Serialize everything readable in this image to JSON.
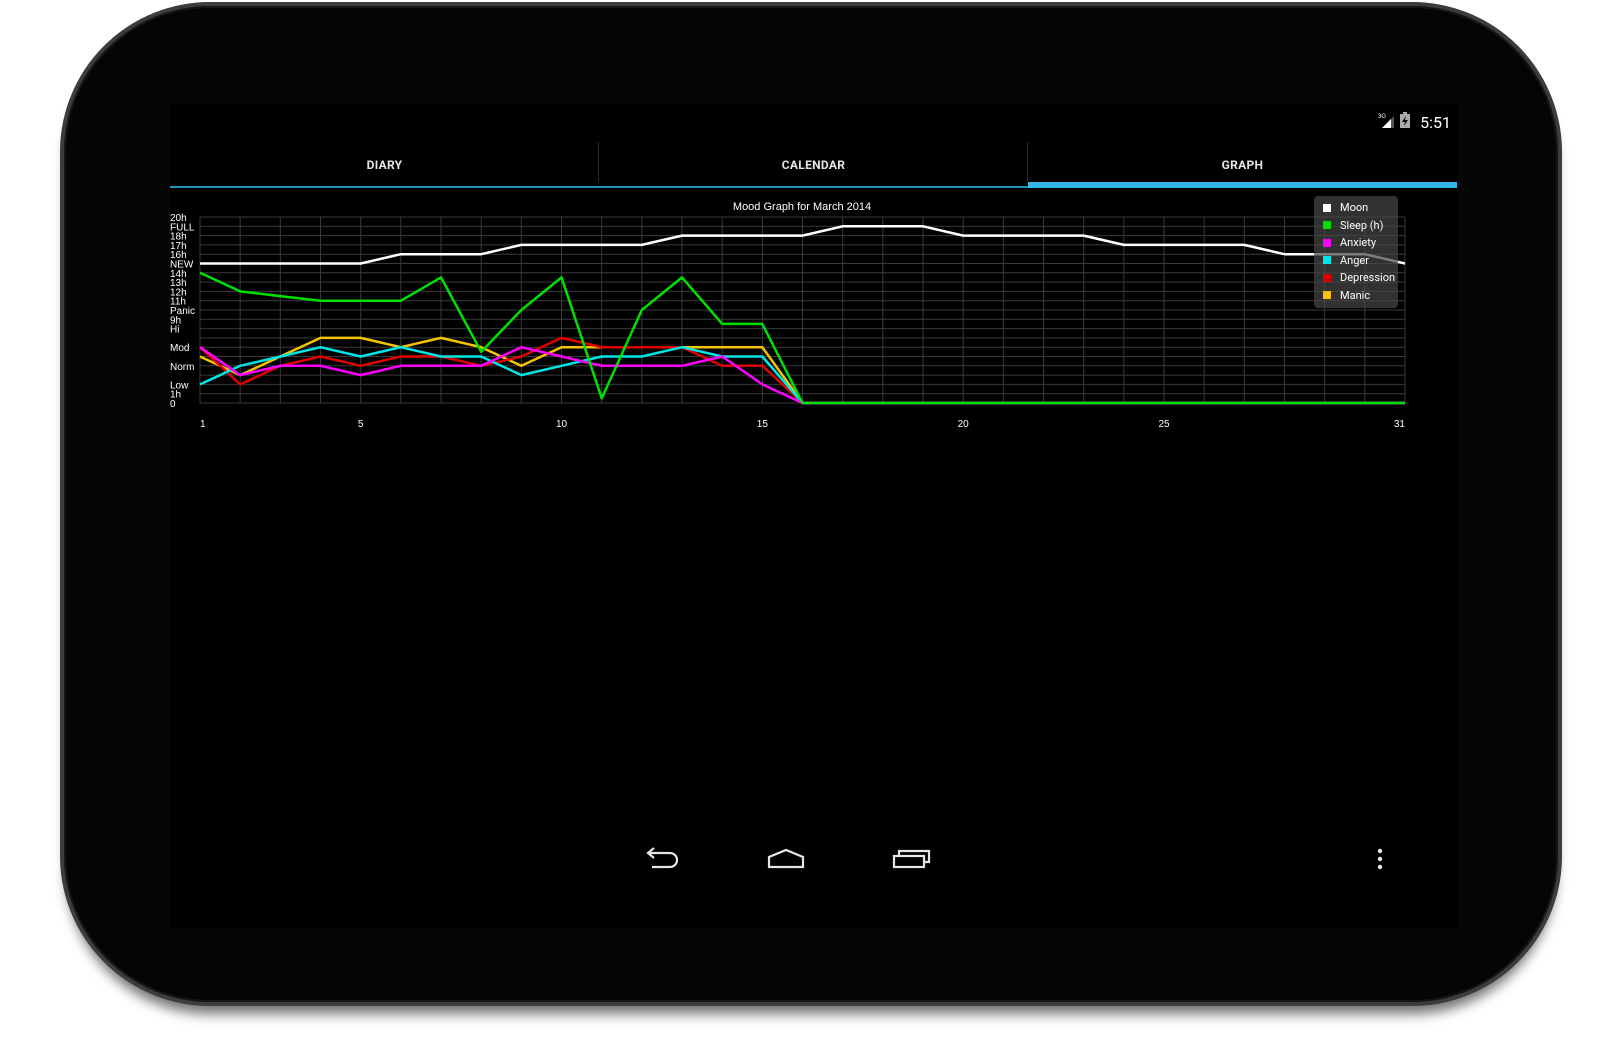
{
  "status_bar": {
    "network_label": "3G",
    "time": "5:51",
    "icons": [
      "signal-3g-icon",
      "battery-charging-icon"
    ]
  },
  "tabs": [
    {
      "label": "DIARY",
      "selected": false
    },
    {
      "label": "CALENDAR",
      "selected": false
    },
    {
      "label": "GRAPH",
      "selected": true
    }
  ],
  "colors": {
    "accent": "#33b5e5",
    "tab_indicator": "#2390b8",
    "moon": "#ffffff",
    "sleep": "#00e000",
    "anxiety": "#ff00ff",
    "anger": "#00e5e5",
    "depression": "#e00000",
    "manic": "#f5c400"
  },
  "chart_data": {
    "type": "line",
    "title": "Mood Graph for March 2014",
    "x_ticks": [
      1,
      5,
      10,
      15,
      20,
      25,
      31
    ],
    "xlim": [
      1,
      31
    ],
    "ylim": [
      0,
      20
    ],
    "grid": true,
    "legend_position": "top-right",
    "y_tick_labels": [
      {
        "v": 20,
        "label": "20h"
      },
      {
        "v": 19,
        "label": "FULL"
      },
      {
        "v": 18,
        "label": "18h"
      },
      {
        "v": 17,
        "label": "17h"
      },
      {
        "v": 16,
        "label": "16h"
      },
      {
        "v": 15,
        "label": "NEW"
      },
      {
        "v": 14,
        "label": "14h"
      },
      {
        "v": 13,
        "label": "13h"
      },
      {
        "v": 12,
        "label": "12h"
      },
      {
        "v": 11,
        "label": "11h"
      },
      {
        "v": 10,
        "label": "Panic"
      },
      {
        "v": 9,
        "label": "9h"
      },
      {
        "v": 8,
        "label": "Hi"
      },
      {
        "v": 6,
        "label": "Mod"
      },
      {
        "v": 4,
        "label": "Norm"
      },
      {
        "v": 2,
        "label": "Low"
      },
      {
        "v": 1,
        "label": "1h"
      },
      {
        "v": 0,
        "label": "0"
      }
    ],
    "series": [
      {
        "name": "Moon",
        "color": "#ffffff",
        "x": [
          1,
          2,
          3,
          4,
          5,
          6,
          7,
          8,
          9,
          10,
          11,
          12,
          13,
          14,
          15,
          16,
          17,
          18,
          19,
          20,
          21,
          22,
          23,
          24,
          25,
          26,
          27,
          28,
          29,
          30,
          31
        ],
        "values": [
          15,
          15,
          15,
          15,
          15,
          16,
          16,
          16,
          17,
          17,
          17,
          17,
          18,
          18,
          18,
          18,
          19,
          19,
          19,
          18,
          18,
          18,
          18,
          17,
          17,
          17,
          17,
          16,
          16,
          16,
          15
        ]
      },
      {
        "name": "Sleep (h)",
        "color": "#00e000",
        "x": [
          1,
          2,
          3,
          4,
          5,
          6,
          7,
          8,
          9,
          10,
          11,
          12,
          13,
          14,
          15,
          16,
          17,
          18,
          19,
          20,
          21,
          22,
          23,
          24,
          25,
          26,
          27,
          28,
          29,
          30,
          31
        ],
        "values": [
          14,
          12,
          11.5,
          11,
          11,
          11,
          13.5,
          5.5,
          10,
          13.5,
          0.5,
          10,
          13.5,
          8.5,
          8.5,
          0,
          0,
          0,
          0,
          0,
          0,
          0,
          0,
          0,
          0,
          0,
          0,
          0,
          0,
          0,
          0
        ]
      },
      {
        "name": "Anxiety",
        "color": "#ff00ff",
        "x": [
          1,
          2,
          3,
          4,
          5,
          6,
          7,
          8,
          9,
          10,
          11,
          12,
          13,
          14,
          15,
          16,
          17,
          18,
          19,
          20,
          21,
          22,
          23,
          24,
          25,
          26,
          27,
          28,
          29,
          30,
          31
        ],
        "values": [
          6,
          3,
          4,
          4,
          3,
          4,
          4,
          4,
          6,
          5,
          4,
          4,
          4,
          5,
          2,
          0,
          0,
          0,
          0,
          0,
          0,
          0,
          0,
          0,
          0,
          0,
          0,
          0,
          0,
          0,
          0
        ]
      },
      {
        "name": "Anger",
        "color": "#00e5e5",
        "x": [
          1,
          2,
          3,
          4,
          5,
          6,
          7,
          8,
          9,
          10,
          11,
          12,
          13,
          14,
          15,
          16,
          17,
          18,
          19,
          20,
          21,
          22,
          23,
          24,
          25,
          26,
          27,
          28,
          29,
          30,
          31
        ],
        "values": [
          2,
          4,
          5,
          6,
          5,
          6,
          5,
          5,
          3,
          4,
          5,
          5,
          6,
          5,
          5,
          0,
          0,
          0,
          0,
          0,
          0,
          0,
          0,
          0,
          0,
          0,
          0,
          0,
          0,
          0,
          0
        ]
      },
      {
        "name": "Depression",
        "color": "#e00000",
        "x": [
          1,
          2,
          3,
          4,
          5,
          6,
          7,
          8,
          9,
          10,
          11,
          12,
          13,
          14,
          15,
          16,
          17,
          18,
          19,
          20,
          21,
          22,
          23,
          24,
          25,
          26,
          27,
          28,
          29,
          30,
          31
        ],
        "values": [
          6,
          2,
          4,
          5,
          4,
          5,
          5,
          4,
          5,
          7,
          6,
          6,
          6,
          4,
          4,
          0,
          0,
          0,
          0,
          0,
          0,
          0,
          0,
          0,
          0,
          0,
          0,
          0,
          0,
          0,
          0
        ]
      },
      {
        "name": "Manic",
        "color": "#f5c400",
        "x": [
          1,
          2,
          3,
          4,
          5,
          6,
          7,
          8,
          9,
          10,
          11,
          12,
          13,
          14,
          15,
          16,
          17,
          18,
          19,
          20,
          21,
          22,
          23,
          24,
          25,
          26,
          27,
          28,
          29,
          30,
          31
        ],
        "values": [
          5,
          3,
          5,
          7,
          7,
          6,
          7,
          6,
          4,
          6,
          6,
          6,
          6,
          6,
          6,
          0,
          0,
          0,
          0,
          0,
          0,
          0,
          0,
          0,
          0,
          0,
          0,
          0,
          0,
          0,
          0
        ]
      }
    ]
  },
  "nav_bar": {
    "buttons": [
      "back-button",
      "home-button",
      "recent-apps-button",
      "overflow-menu-button"
    ]
  }
}
